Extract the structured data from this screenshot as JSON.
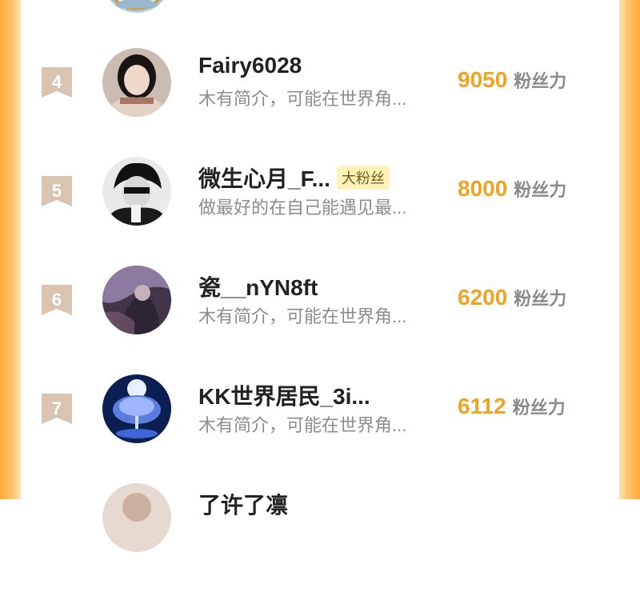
{
  "rows": [
    {
      "rank": "4",
      "name": "Fairy6028",
      "badge": "",
      "bio": "木有简介，可能在世界角...",
      "score": "9050",
      "score_label": "粉丝力"
    },
    {
      "rank": "5",
      "name": "微生心月_F...",
      "badge": "大粉丝",
      "bio": "做最好的在自己能遇见最...",
      "score": "8000",
      "score_label": "粉丝力"
    },
    {
      "rank": "6",
      "name": "瓷__nYN8ft",
      "badge": "",
      "bio": "木有简介，可能在世界角...",
      "score": "6200",
      "score_label": "粉丝力"
    },
    {
      "rank": "7",
      "name": "KK世界居民_3i...",
      "badge": "",
      "bio": "木有简介，可能在世界角...",
      "score": "6112",
      "score_label": "粉丝力"
    }
  ],
  "partial_name_bottom": "了许了凛",
  "colors": {
    "accent": "#f0a321",
    "rank_ribbon": "#d9c4b2",
    "edge": "#ffab3a",
    "badge_bg": "#fdf2b8"
  },
  "icons": {
    "rank_ribbon": "ribbon-icon",
    "avatar": "avatar-image"
  }
}
